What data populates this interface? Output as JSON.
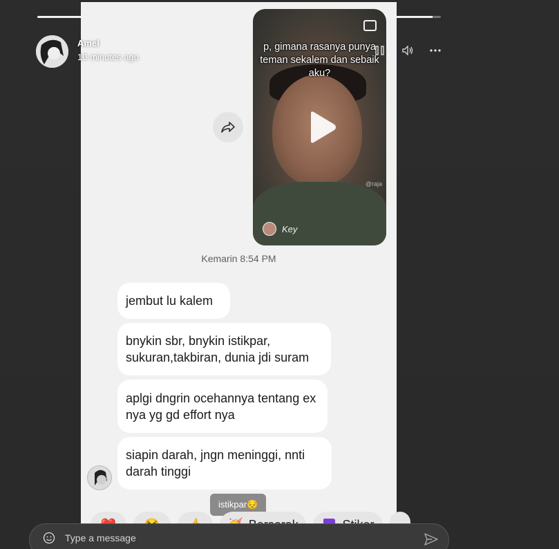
{
  "story": {
    "progress": 0.98,
    "author": "Amel",
    "time_ago": "10 minutes ago"
  },
  "controls": {
    "pause_icon": "pause-icon",
    "volume_icon": "volume-icon",
    "more_icon": "more-icon"
  },
  "video": {
    "caption": "p, gimana rasanya punya teman sekalem dan sebaik aku?",
    "tag": "Key",
    "watermark": "@raja"
  },
  "timestamp": "Kemarin 8:54 PM",
  "messages": [
    {
      "text": "jembut lu kalem"
    },
    {
      "text": "bnykin sbr, bnykin istikpar, sukuran,takbiran, dunia jdi suram"
    },
    {
      "text": "aplgi dngrin ocehannya tentang ex nya yg gd effort nya"
    },
    {
      "text": "siapin darah, jngn meninggi, nnti darah tinggi"
    }
  ],
  "reply_chip": "istikpar😔",
  "reactions": {
    "heart": "❤️",
    "laugh": "😂",
    "thumbs": "👍",
    "cheer_emoji": "🥳",
    "cheer_label": "Bersorak",
    "sticker_label": "Stiker"
  },
  "composer": {
    "placeholder": "Type a message"
  },
  "colors": {
    "background": "#2b2b2b",
    "bubble": "#ffffff",
    "chat_background": "#f1f1f1"
  }
}
